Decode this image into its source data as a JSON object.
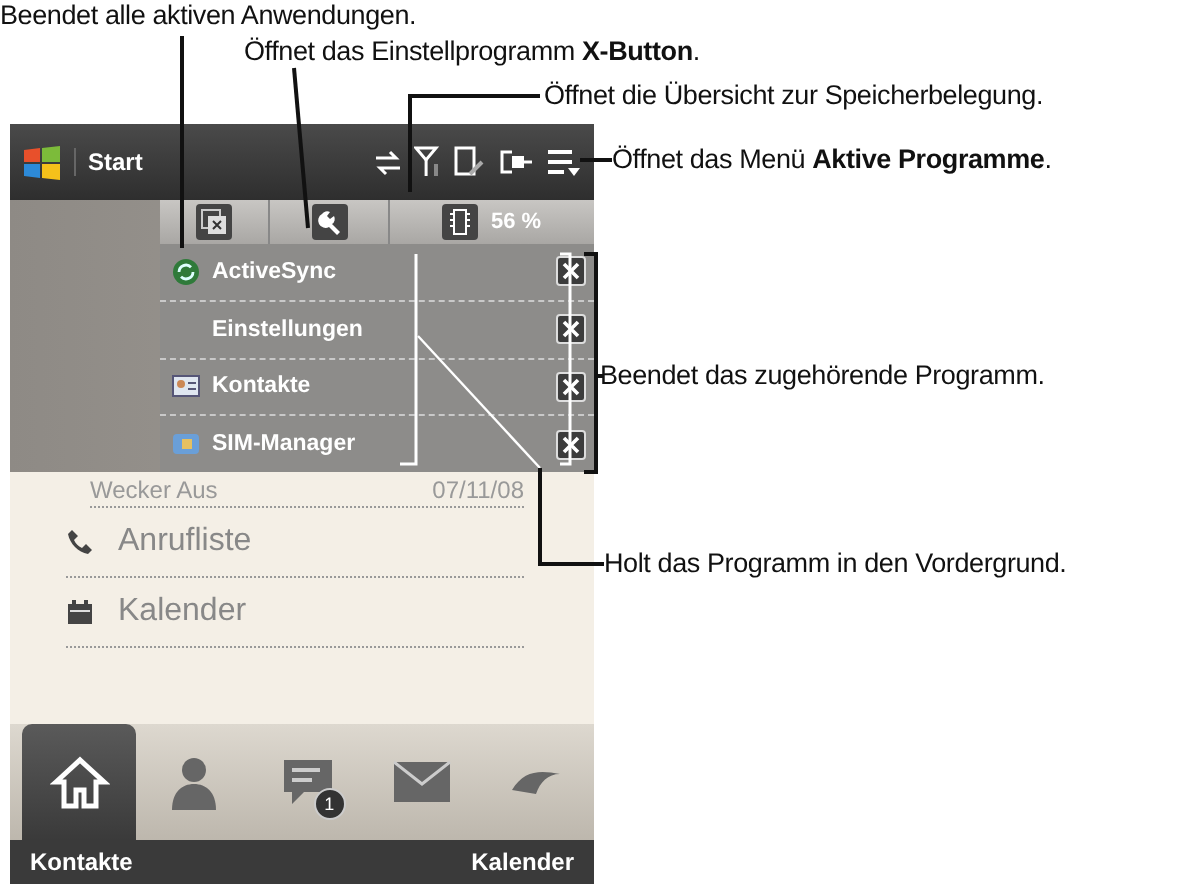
{
  "callouts": [
    {
      "text": "Beendet alle aktiven Anwendungen."
    },
    {
      "text": "Öffnet das Einstellprogramm **X-Button**."
    },
    {
      "text": "Öffnet die Übersicht zur Speicherbelegung."
    },
    {
      "text": "Öffnet das Menü **Aktive Programme**."
    },
    {
      "text": "Beendet das zugehörende Programm."
    },
    {
      "text": "Holt das Programm in den Vordergrund."
    }
  ],
  "status_bar": {
    "start_label": "Start"
  },
  "quick_buttons": {
    "memory_reading": "56 %"
  },
  "task_menu": {
    "items": [
      {
        "name": "ActiveSync",
        "kind": "sync"
      },
      {
        "name": "Einstellungen",
        "kind": "none"
      },
      {
        "name": "Kontakte",
        "kind": "contacts"
      },
      {
        "name": "SIM-Manager",
        "kind": "sim"
      }
    ]
  },
  "home": {
    "alarm": {
      "label": "Wecker Aus",
      "date": "07/11/08"
    },
    "items": [
      {
        "label": "Anrufliste",
        "kind": "calls"
      },
      {
        "label": "Kalender",
        "kind": "calendar"
      }
    ]
  },
  "tab_bar": {
    "tabs": [
      {
        "kind": "home",
        "selected": true
      },
      {
        "kind": "person",
        "selected": false
      },
      {
        "kind": "messages",
        "selected": false,
        "badge": "1"
      },
      {
        "kind": "mail",
        "selected": false
      },
      {
        "kind": "more",
        "selected": false
      }
    ]
  },
  "softkeys": {
    "left": "Kontakte",
    "right": "Kalender"
  }
}
